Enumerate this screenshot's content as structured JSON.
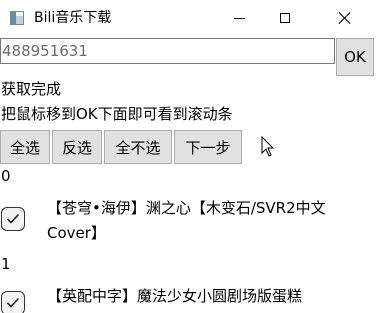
{
  "window": {
    "title": "Bili音乐下载",
    "icon": "app-window-icon",
    "controls": [
      "minimize-icon",
      "maximize-icon",
      "close-icon"
    ]
  },
  "input": {
    "value": "488951631"
  },
  "ok_button": {
    "label": "OK"
  },
  "status": {
    "line1": "获取完成",
    "line2": "把鼠标移到OK下面即可看到滚动条"
  },
  "buttons": {
    "select_all": "全选",
    "invert": "反选",
    "select_none": "全不选",
    "next": "下一步"
  },
  "items": [
    {
      "index": "0",
      "checked": true,
      "title": "【苍穹•海伊】渊之心【木变石/SVR2中文Cover】"
    },
    {
      "index": "1",
      "checked": true,
      "title": "【英配中字】魔法少女小圆剧场版蛋糕"
    }
  ]
}
